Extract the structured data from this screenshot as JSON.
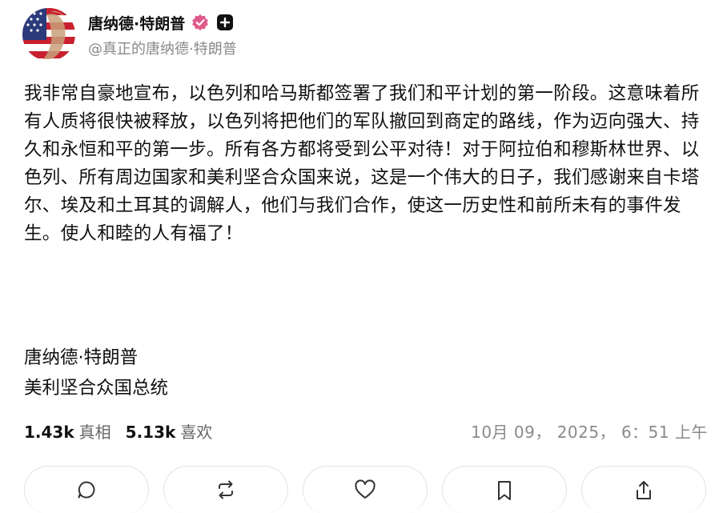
{
  "author": {
    "display_name": "唐纳德·特朗普",
    "handle": "@真正的唐纳德·特朗普",
    "verified_color": "#e05a8a"
  },
  "post": {
    "body": "我非常自豪地宣布，以色列和哈马斯都签署了我们和平计划的第一阶段。这意味着所有人质将很快被释放，以色列将把他们的军队撤回到商定的路线，作为迈向强大、持久和永恒和平的第一步。所有各方都将受到公平对待！对于阿拉伯和穆斯林世界、以色列、所有周边国家和美利坚合众国来说，这是一个伟大的日子，我们感谢来自卡塔尔、埃及和土耳其的调解人，他们与我们合作，使这一历史性和前所未有的事件发生。使人和睦的人有福了！",
    "signature_name": "唐纳德·特朗普",
    "signature_title": "美利坚合众国总统"
  },
  "stats": {
    "retruths_count": "1.43k",
    "retruths_label": "真相",
    "likes_count": "5.13k",
    "likes_label": "喜欢"
  },
  "timestamp": "10月 09， 2025， 6：51 上午",
  "actions": [
    {
      "icon": "reply-icon"
    },
    {
      "icon": "repost-icon"
    },
    {
      "icon": "heart-icon"
    },
    {
      "icon": "bookmark-icon"
    },
    {
      "icon": "share-icon"
    }
  ]
}
